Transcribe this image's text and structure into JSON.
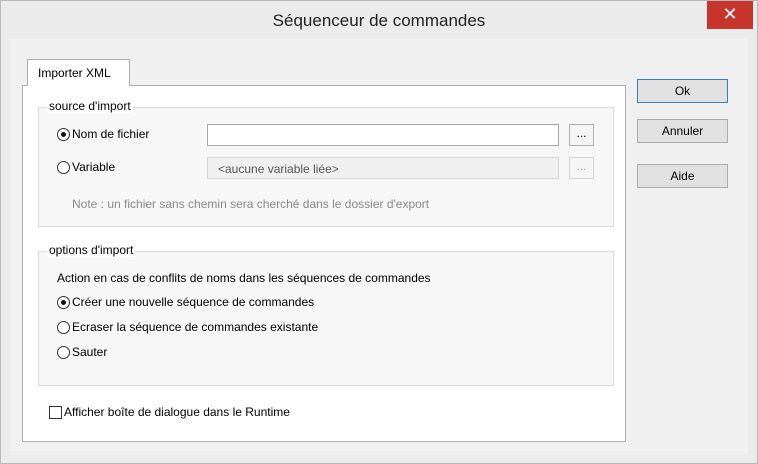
{
  "window": {
    "title": "Séquenceur de commandes",
    "close_glyph": "✕"
  },
  "tabs": [
    {
      "label": "Importer XML"
    }
  ],
  "import_source": {
    "group_title": "source d'import",
    "file_option_label": "Nom de fichier",
    "file_value": "",
    "browse_label": "...",
    "variable_option_label": "Variable",
    "variable_value": "<aucune variable liée>",
    "note": "Note : un fichier sans chemin sera cherché dans le dossier d'export"
  },
  "import_options": {
    "group_title": "options d'import",
    "conflict_label": "Action en cas de conflits de noms dans les séquences de commandes",
    "options": [
      {
        "label": "Créer une nouvelle séquence de commandes",
        "selected": true
      },
      {
        "label": "Ecraser la séquence de commandes existante",
        "selected": false
      },
      {
        "label": "Sauter",
        "selected": false
      }
    ]
  },
  "runtime_checkbox": {
    "label": "Afficher boîte de dialogue dans le Runtime",
    "checked": false
  },
  "buttons": {
    "ok": "Ok",
    "cancel": "Annuler",
    "help": "Aide"
  },
  "colors": {
    "close_button": "#c7342b",
    "default_button_border": "#3c7fb1"
  }
}
